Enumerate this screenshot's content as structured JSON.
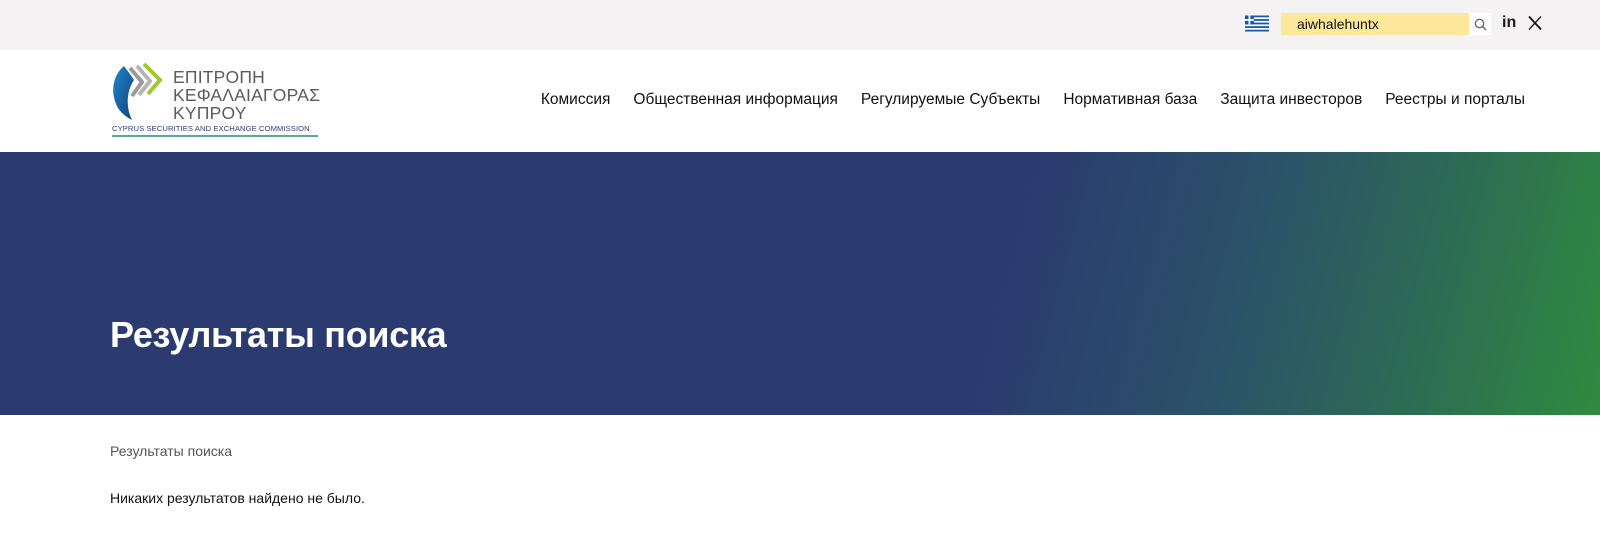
{
  "topbar": {
    "language_flag_icon": "greece-flag-icon",
    "search": {
      "value": "aiwhalehuntx",
      "button_icon": "search-icon"
    },
    "social": {
      "linkedin_label": "in",
      "x_icon": "x-twitter-icon"
    }
  },
  "logo": {
    "line1": "ΕΠΙΤΡΟΠΗ",
    "line2": "ΚΕΦΑΛΑΙΑΓΟΡΑΣ",
    "line3": "ΚΥΠΡΟΥ",
    "subtitle": "CYPRUS SECURITIES AND EXCHANGE COMMISSION"
  },
  "nav": {
    "items": [
      {
        "label": "Комиссия"
      },
      {
        "label": "Общественная информация"
      },
      {
        "label": "Регулируемые Субъекты"
      },
      {
        "label": "Нормативная база"
      },
      {
        "label": "Защита инвесторов"
      },
      {
        "label": "Реестры и порталы"
      }
    ]
  },
  "hero": {
    "title": "Результаты поиска"
  },
  "content": {
    "breadcrumb": "Результаты поиска",
    "message": "Никаких результатов найдено не было."
  },
  "colors": {
    "topbar_bg": "#f4f2f3",
    "search_bg": "#fde79a",
    "hero_blue": "#2b3b70",
    "hero_green": "#2f8b3f"
  }
}
